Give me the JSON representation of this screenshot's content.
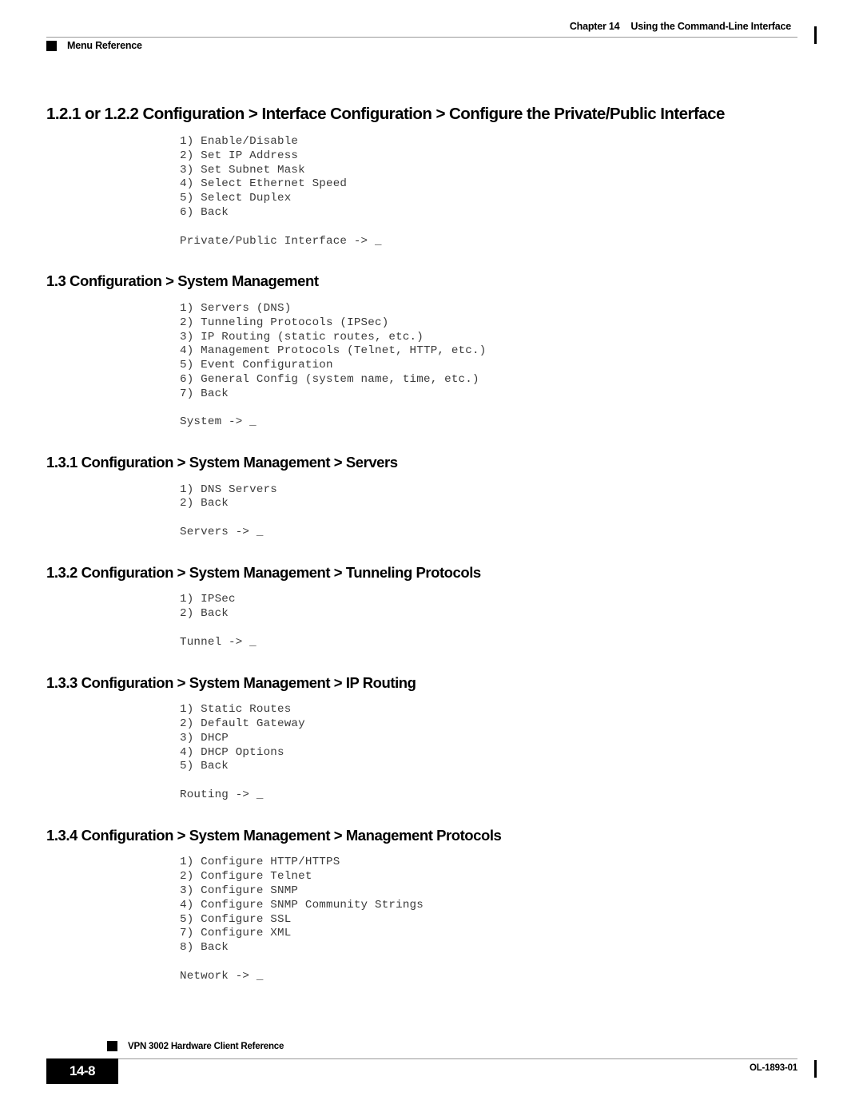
{
  "header": {
    "chapter_number": "Chapter 14",
    "chapter_title": "Using the Command-Line Interface",
    "running_subhead": "Menu Reference"
  },
  "sections": [
    {
      "heading": "1.2.1 or 1.2.2 Configuration > Interface Configuration > Configure the Private/Public Interface",
      "level": 1,
      "menu": "1) Enable/Disable\n2) Set IP Address\n3) Set Subnet Mask\n4) Select Ethernet Speed\n5) Select Duplex\n6) Back\n\nPrivate/Public Interface -> _"
    },
    {
      "heading": "1.3 Configuration > System Management",
      "level": 2,
      "menu": "1) Servers (DNS)\n2) Tunneling Protocols (IPSec)\n3) IP Routing (static routes, etc.)\n4) Management Protocols (Telnet, HTTP, etc.)\n5) Event Configuration\n6) General Config (system name, time, etc.)\n7) Back\n\nSystem -> _"
    },
    {
      "heading": "1.3.1 Configuration > System Management > Servers",
      "level": 2,
      "menu": "1) DNS Servers\n2) Back\n\nServers -> _"
    },
    {
      "heading": "1.3.2 Configuration > System Management > Tunneling Protocols",
      "level": 2,
      "menu": "1) IPSec\n2) Back\n\nTunnel -> _"
    },
    {
      "heading": "1.3.3 Configuration > System Management > IP Routing",
      "level": 2,
      "menu": "1) Static Routes\n2) Default Gateway\n3) DHCP\n4) DHCP Options\n5) Back\n\nRouting -> _"
    },
    {
      "heading": "1.3.4 Configuration > System Management > Management Protocols",
      "level": 2,
      "menu": "1) Configure HTTP/HTTPS\n2) Configure Telnet\n3) Configure SNMP\n4) Configure SNMP Community Strings\n5) Configure SSL\n7) Configure XML\n8) Back\n\nNetwork -> _"
    }
  ],
  "footer": {
    "document_title": "VPN 3002 Hardware Client Reference",
    "page_number": "14-8",
    "document_id": "OL-1893-01"
  }
}
